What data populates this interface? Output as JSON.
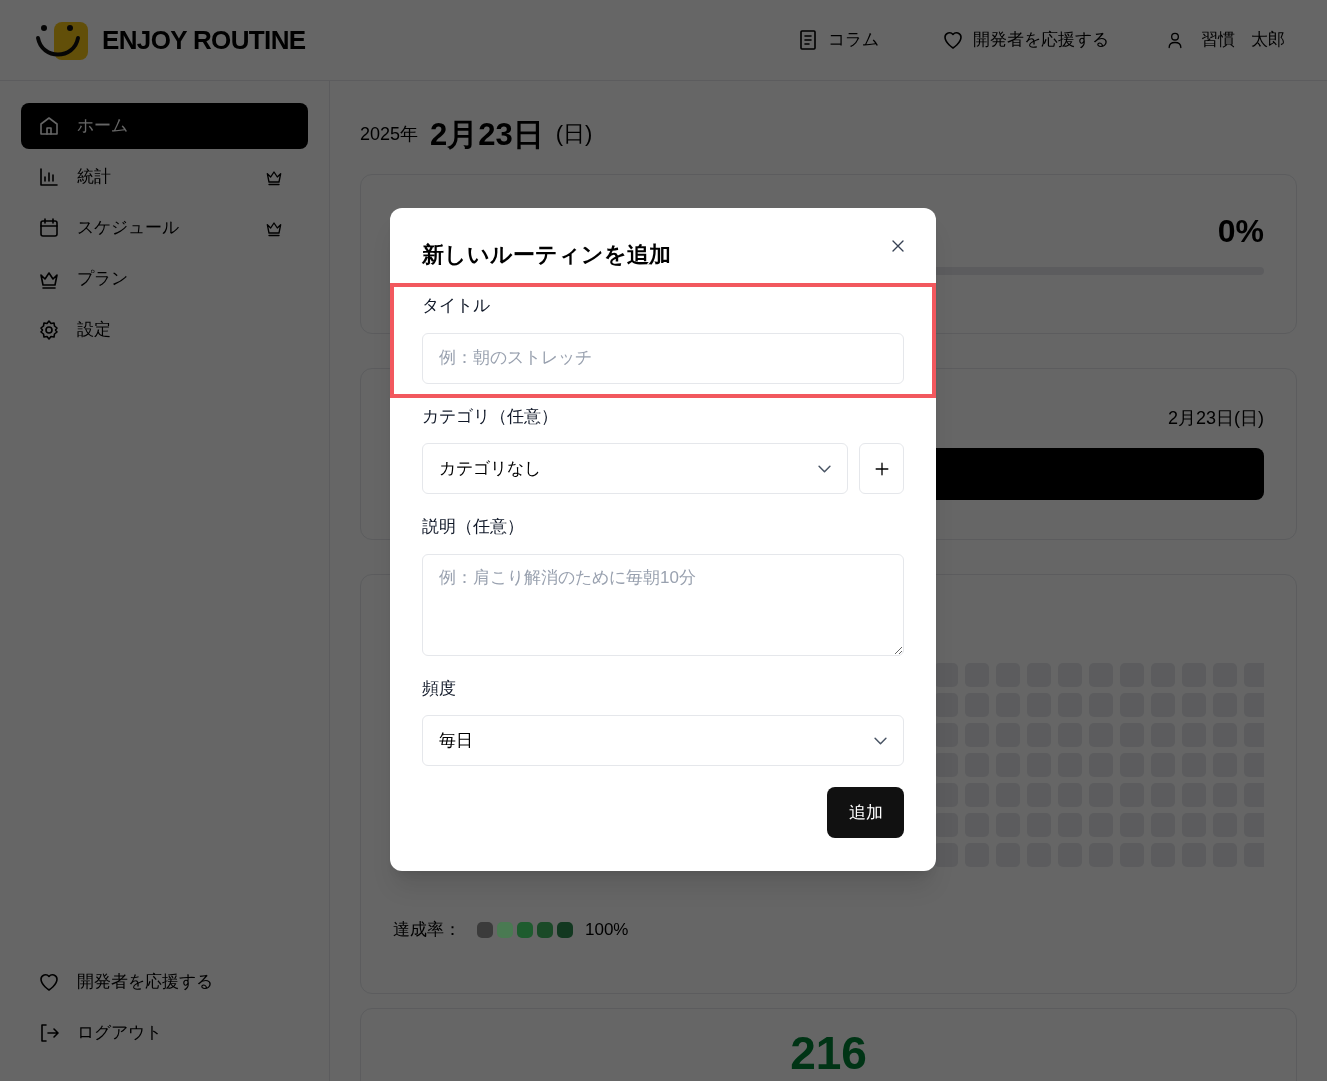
{
  "header": {
    "logo_text": "ENJOY ROUTINE",
    "nav": [
      {
        "label": "コラム"
      },
      {
        "label": "開発者を応援する"
      }
    ],
    "user": {
      "name_parts": [
        "習慣",
        "太郎"
      ]
    }
  },
  "sidebar": {
    "items": [
      {
        "label": "ホーム",
        "selected": true,
        "premium": false
      },
      {
        "label": "統計",
        "selected": false,
        "premium": true
      },
      {
        "label": "スケジュール",
        "selected": false,
        "premium": true
      },
      {
        "label": "プラン",
        "selected": false,
        "premium": false
      },
      {
        "label": "設定",
        "selected": false,
        "premium": false
      }
    ],
    "footer_items": [
      {
        "label": "開発者を応援する"
      },
      {
        "label": "ログアウト"
      }
    ]
  },
  "main": {
    "date": {
      "year": "2025年",
      "day": "2月23日",
      "weekday": "(日)"
    },
    "progress_card": {
      "percent": "0%",
      "level": 0
    },
    "today_card": {
      "date": "2月23日(日)"
    },
    "heatmap_card": {
      "legend_label": "達成率：",
      "legend_swatches": [
        {
          "color": "#3b3b3b"
        },
        {
          "color": "#4a7a52"
        },
        {
          "color": "#1e5c2e"
        },
        {
          "color": "#1a4a27"
        },
        {
          "color": "#123820"
        }
      ],
      "legend_max": "100%"
    },
    "stats_card": {
      "value": "216"
    }
  },
  "dialog": {
    "title": "新しいルーティンを追加",
    "fields": [
      {
        "kind": "text",
        "label": "タイトル",
        "placeholder": "例：朝のストレッチ",
        "highlighted": true
      },
      {
        "kind": "select_add",
        "label": "カテゴリ（任意）",
        "value": "カテゴリなし",
        "highlighted": false
      },
      {
        "kind": "textarea",
        "label": "説明（任意）",
        "placeholder": "例：肩こり解消のために毎朝10分",
        "highlighted": false
      },
      {
        "kind": "select",
        "label": "頻度",
        "value": "毎日",
        "highlighted": false
      }
    ],
    "submit": "追加"
  }
}
